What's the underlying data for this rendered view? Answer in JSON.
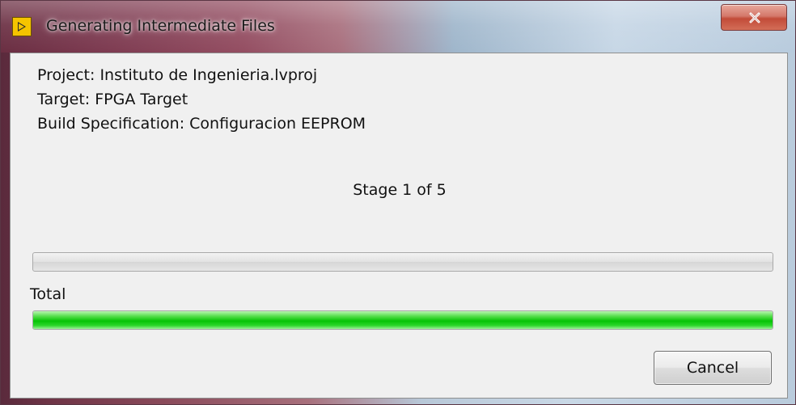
{
  "window": {
    "title": "Generating Intermediate Files",
    "close_icon": "close-icon",
    "app_icon": "labview-run-icon"
  },
  "info": {
    "project": "Project: Instituto de Ingenieria.lvproj",
    "target": "Target: FPGA Target",
    "build_spec": "Build Specification: Configuracion EEPROM"
  },
  "stage": {
    "text": "Stage 1 of 5",
    "progress_fraction": 0.0
  },
  "total": {
    "label": "Total",
    "progress_fraction": 1.0,
    "fill_color": "#06c406"
  },
  "actions": {
    "cancel_label": "Cancel"
  }
}
